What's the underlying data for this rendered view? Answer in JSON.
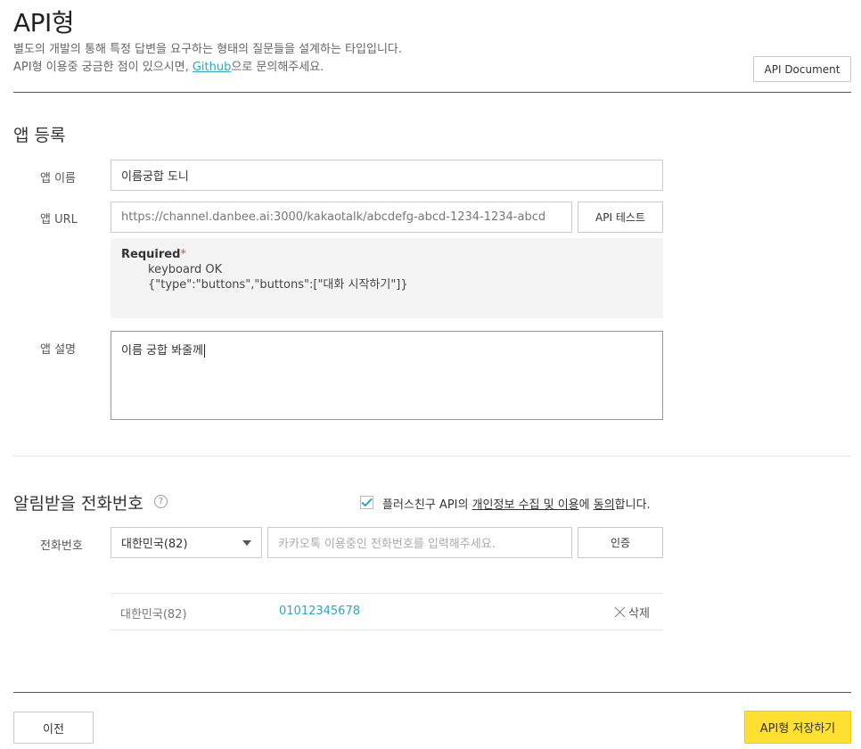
{
  "header": {
    "title": "API형",
    "desc_line1": "별도의 개발의 통해 특정 답변을 요구하는 형태의 질문들을 설계하는 타입입니다.",
    "desc_line2_pre": "API형 이용중 궁금한 점이 있으시면, ",
    "desc_link": "Github",
    "desc_line2_post": "으로 문의해주세요.",
    "api_document_label": "API Document"
  },
  "app_register": {
    "section_title": "앱 등록",
    "name_label": "앱 이름",
    "name_value": "이름궁합 도니",
    "url_label": "앱 URL",
    "url_value": "https://channel.danbee.ai:3000/kakaotalk/abcdefg-abcd-1234-1234-abcd",
    "api_test_label": "API 테스트",
    "required_title": "Required",
    "required_star": "*",
    "required_line1": "keyboard OK",
    "required_line2": "{\"type\":\"buttons\",\"buttons\":[\"대화 시작하기\"]}",
    "desc_label": "앱 설명",
    "desc_value": "이름 궁합 봐줄께"
  },
  "phone": {
    "section_title": "알림받을 전화번호",
    "help_icon_glyph": "?",
    "agree_pre": "플러스친구 API의 ",
    "agree_link1": "개인정보 수집 및 이용",
    "agree_mid": "에 ",
    "agree_link2": "동의",
    "agree_post": "합니다.",
    "agree_checked": true,
    "phone_label": "전화번호",
    "country_selected": "대한민국(82)",
    "phone_placeholder": "카카오톡 이용중인 전화번호를 입력해주세요.",
    "verify_label": "인증",
    "registered": [
      {
        "country": "대한민국(82)",
        "number": "01012345678",
        "delete_label": "삭제"
      }
    ]
  },
  "footer": {
    "prev_label": "이전",
    "save_label": "API형 저장하기"
  },
  "colors": {
    "accent": "#2ba8c4",
    "save_button": "#ffe033",
    "required_star": "#e4463c"
  }
}
